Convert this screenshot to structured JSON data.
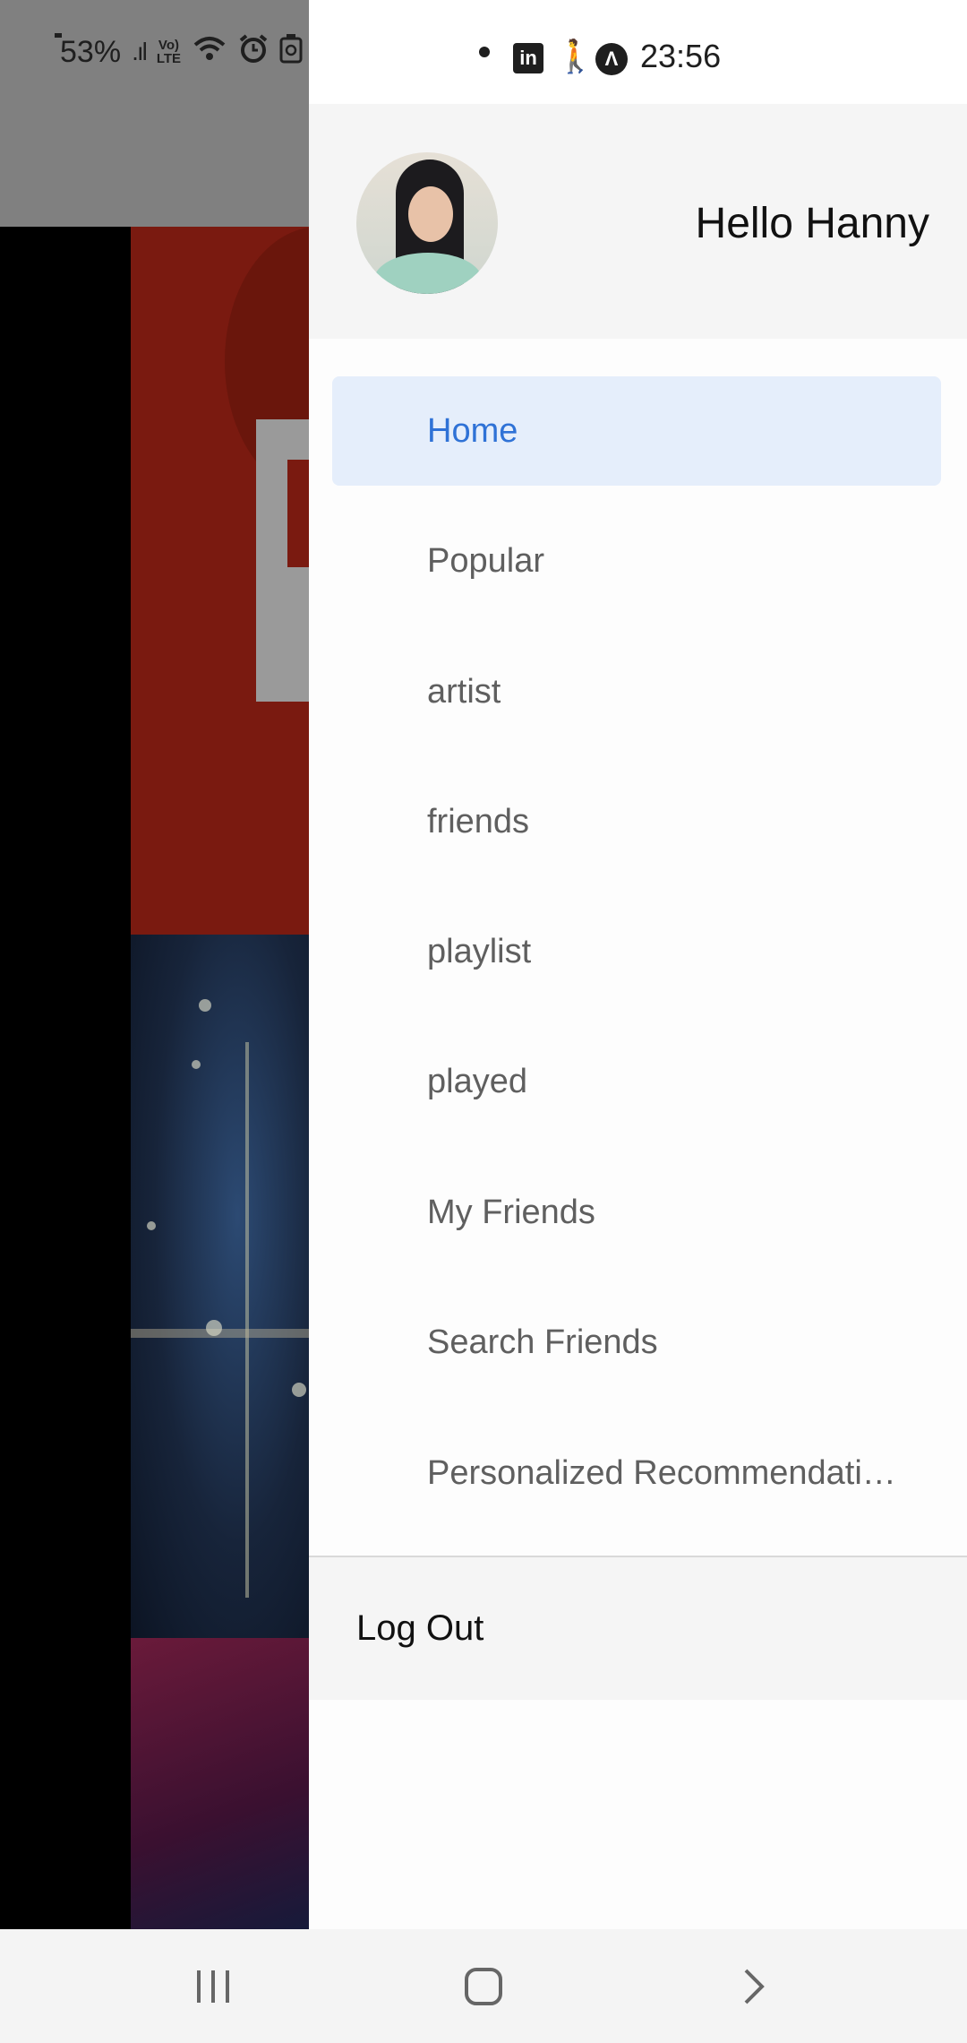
{
  "status_bar": {
    "battery": "53%",
    "time": "23:56"
  },
  "drawer": {
    "greeting": "Hello Hanny",
    "menu_items": [
      {
        "label": "Home",
        "active": true
      },
      {
        "label": "Popular",
        "active": false
      },
      {
        "label": "artist",
        "active": false
      },
      {
        "label": "friends",
        "active": false
      },
      {
        "label": "playlist",
        "active": false
      },
      {
        "label": "played",
        "active": false
      },
      {
        "label": "My Friends",
        "active": false
      },
      {
        "label": "Search Friends",
        "active": false
      },
      {
        "label": "Personalized Recommendati…",
        "active": false
      }
    ],
    "logout_label": "Log Out"
  },
  "colors": {
    "accent": "#2f72d6",
    "active_background": "#e5eefb",
    "menu_text": "#5f5f5f"
  },
  "icons": {
    "status_left": [
      "battery-icon",
      "signal-icon",
      "volte-icon",
      "wifi-icon",
      "alarm-icon",
      "recycle-icon"
    ],
    "status_right": [
      "notification-dot-icon",
      "linkedin-icon",
      "walking-icon",
      "navigation-icon"
    ],
    "navbar": [
      "recent-apps-icon",
      "home-icon",
      "back-icon"
    ]
  }
}
